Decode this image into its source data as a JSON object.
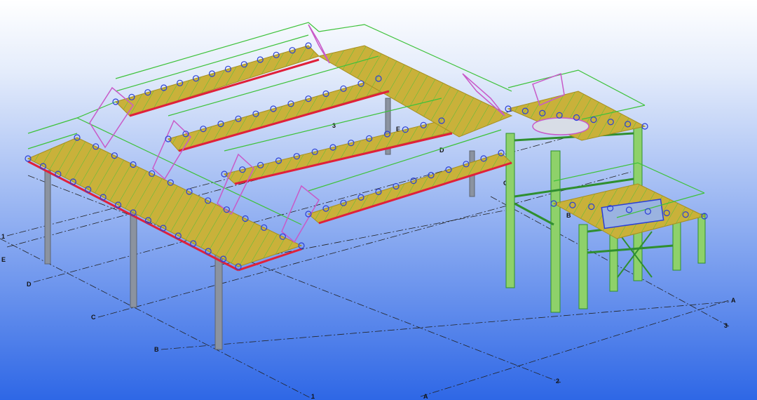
{
  "viewport": {
    "background_top": "#ffffff",
    "background_bottom": "#2e67e6"
  },
  "colors": {
    "deck": "#c9b13a",
    "deck_edge": "#a78f1f",
    "railing": "#3ec23a",
    "railing_dark": "#2a9e2a",
    "stair": "#c85ac8",
    "beam": "#e0203a",
    "column": "#8b93a0",
    "column_green": "#8ed16a",
    "bolt": "#2b3fd6",
    "gridline": "#222222",
    "gusset": "#34d0c8"
  },
  "grid_labels": {
    "left_1": "1",
    "left_E": "E",
    "left_D": "D",
    "left_C": "C",
    "left_B": "B",
    "bottom_1": "1",
    "bottom_A": "A",
    "bottom_2": "2",
    "right_3": "3",
    "right_A": "A",
    "mid_3": "3",
    "mid_E": "E",
    "mid_D": "D",
    "mid_C": "C",
    "mid_B": "B"
  }
}
